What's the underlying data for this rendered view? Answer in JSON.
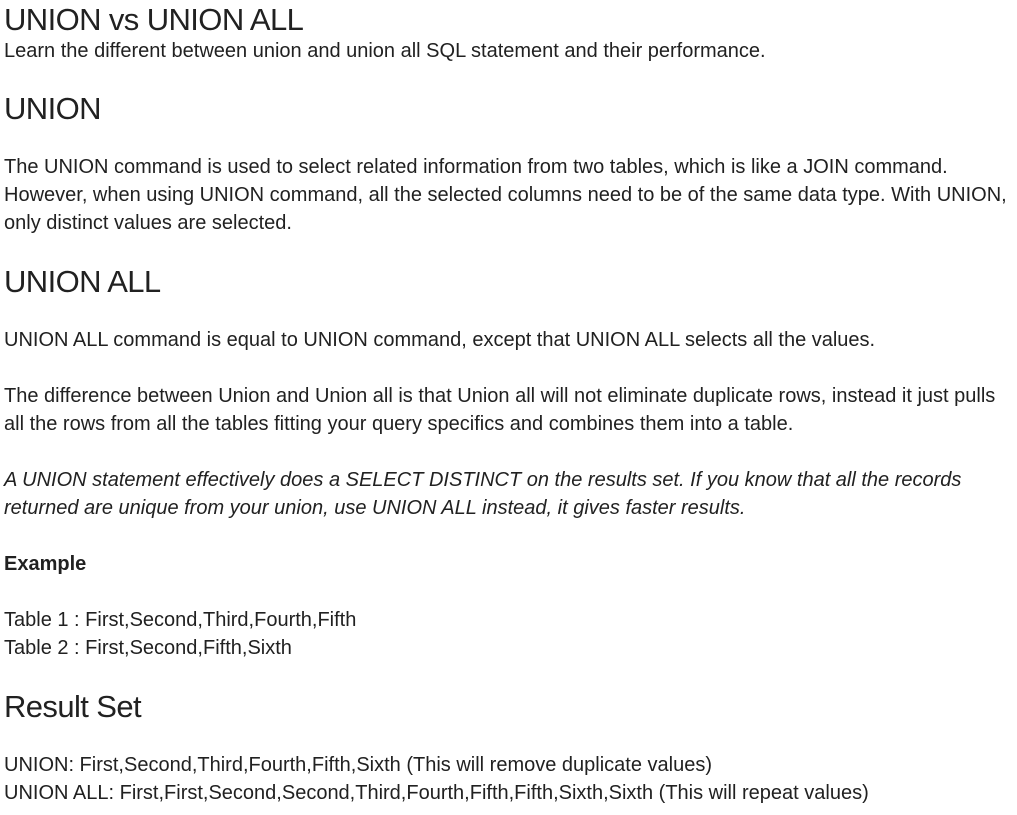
{
  "title": "UNION vs UNION ALL",
  "subtitle": "Learn the different between union and union all SQL statement and their performance.",
  "union_section": {
    "heading": "UNION",
    "paragraph": "The UNION command is used to select related information from two tables, which is like a JOIN command. However, when using UNION command, all the selected columns need to be of the same data type. With UNION, only distinct values are selected."
  },
  "union_all_section": {
    "heading": "UNION ALL",
    "paragraph_1": "UNION ALL command is equal to UNION command, except that UNION ALL selects all the values.",
    "paragraph_2": "The difference between Union and Union all is that Union all will not eliminate duplicate rows, instead it just pulls all the rows from all the tables fitting your query specifics and combines them into a table.",
    "note": "A UNION statement effectively does a SELECT DISTINCT on the results set. If you know that all the records returned are unique from your union, use UNION ALL instead, it gives faster results."
  },
  "example": {
    "label": "Example",
    "table_1": "Table 1 : First,Second,Third,Fourth,Fifth",
    "table_2": "Table 2 : First,Second,Fifth,Sixth"
  },
  "result_set": {
    "heading": "Result Set",
    "union_line": "UNION: First,Second,Third,Fourth,Fifth,Sixth (This will remove duplicate values)",
    "union_all_line": "UNION ALL: First,First,Second,Second,Third,Fourth,Fifth,Fifth,Sixth,Sixth (This will repeat values)"
  }
}
